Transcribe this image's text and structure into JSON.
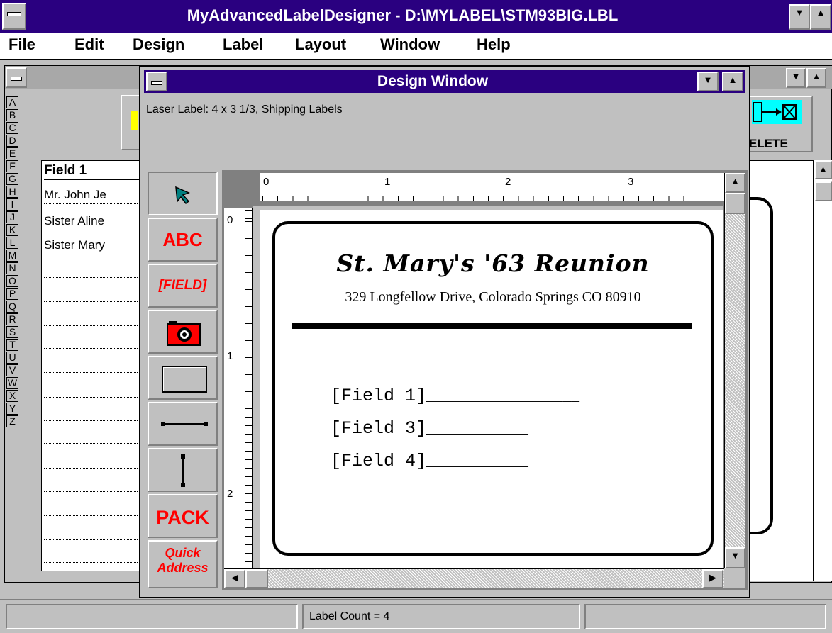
{
  "app": {
    "title": "MyAdvancedLabelDesigner - D:\\MYLABEL\\STM93BIG.LBL"
  },
  "menu": [
    "File",
    "Edit",
    "Design",
    "Label",
    "Layout",
    "Window",
    "Help"
  ],
  "alphabet": [
    "A",
    "B",
    "C",
    "D",
    "E",
    "F",
    "G",
    "H",
    "I",
    "J",
    "K",
    "L",
    "M",
    "N",
    "O",
    "P",
    "Q",
    "R",
    "S",
    "T",
    "U",
    "V",
    "W",
    "X",
    "Y",
    "Z"
  ],
  "data_window": {
    "column_header": "Field 1",
    "rows": [
      "Mr. John Je",
      "Sister Aline",
      "Sister Mary"
    ],
    "delete_button": "ELETE"
  },
  "design_window": {
    "title": "Design Window",
    "label_description": "Laser Label: 4 x 3 1/3, Shipping Labels",
    "tools": [
      "ABC",
      "[FIELD]",
      "PACK",
      "Quick Address"
    ],
    "ruler_h": [
      "0",
      "1",
      "2",
      "3"
    ],
    "ruler_v": [
      "0",
      "1",
      "2"
    ]
  },
  "label": {
    "title": "St. Mary's '63 Reunion",
    "address": "329 Longfellow Drive, Colorado Springs CO 80910",
    "fields": [
      {
        "text": "[Field 1]",
        "line": "__________________"
      },
      {
        "text": "[Field 3]",
        "line": "____________"
      },
      {
        "text": "[Field 4]",
        "line": "____________"
      }
    ]
  },
  "status": {
    "label_count": "Label Count = 4"
  },
  "colors": {
    "titlebar_active": "#2a0080",
    "tool_red": "#ff0000",
    "accent_cyan": "#00ffff"
  }
}
